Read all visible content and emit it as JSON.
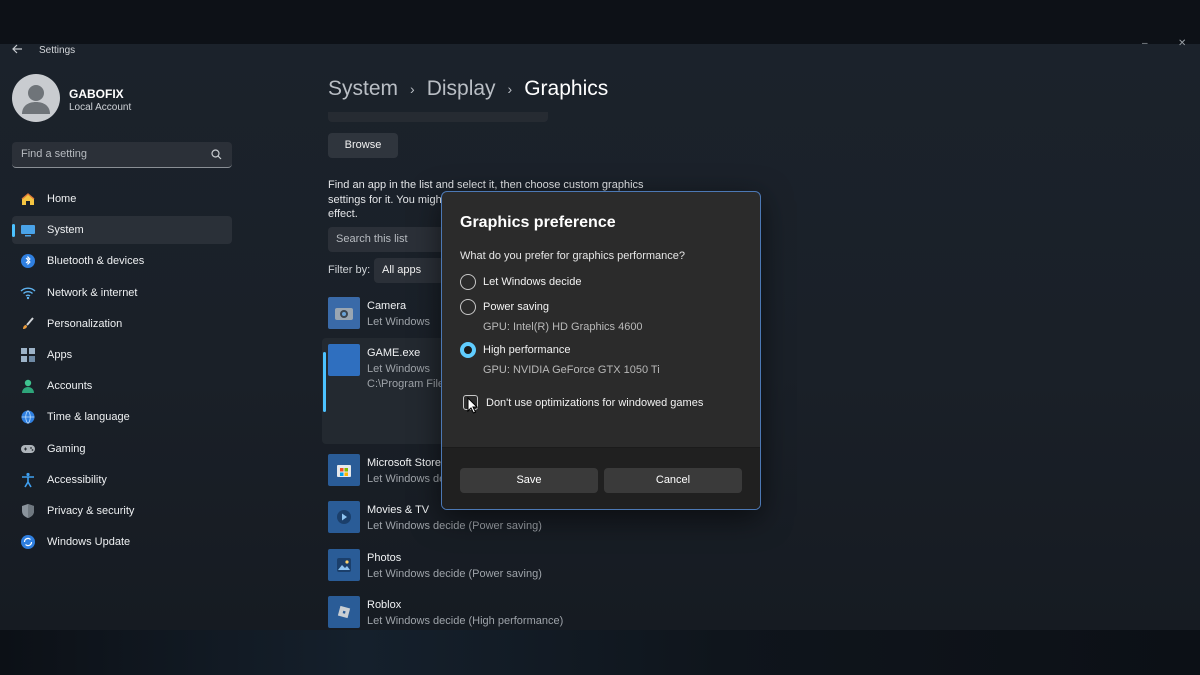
{
  "window": {
    "title": "Settings",
    "minimize_glyph": "–",
    "close_glyph": "✕"
  },
  "profile": {
    "name": "GABOFIX",
    "account_type": "Local Account"
  },
  "search": {
    "placeholder": "Find a setting"
  },
  "nav": {
    "items": [
      {
        "label": "Home",
        "icon": "home-icon"
      },
      {
        "label": "System",
        "icon": "system-icon",
        "active": true
      },
      {
        "label": "Bluetooth & devices",
        "icon": "bluetooth-icon"
      },
      {
        "label": "Network & internet",
        "icon": "wifi-icon"
      },
      {
        "label": "Personalization",
        "icon": "brush-icon"
      },
      {
        "label": "Apps",
        "icon": "apps-icon"
      },
      {
        "label": "Accounts",
        "icon": "person-icon"
      },
      {
        "label": "Time & language",
        "icon": "globe-icon"
      },
      {
        "label": "Gaming",
        "icon": "gamepad-icon"
      },
      {
        "label": "Accessibility",
        "icon": "accessibility-icon"
      },
      {
        "label": "Privacy & security",
        "icon": "shield-icon"
      },
      {
        "label": "Windows Update",
        "icon": "update-icon"
      }
    ]
  },
  "breadcrumb": {
    "items": [
      "System",
      "Display",
      "Graphics"
    ],
    "separator": "›"
  },
  "content": {
    "browse_label": "Browse",
    "description": "Find an app in the list and select it, then choose custom graphics settings for it. You might need to restart the app for changes to take effect.",
    "list_search_placeholder": "Search this list",
    "filter_label": "Filter by:",
    "filter_value": "All apps",
    "apps": [
      {
        "name": "Camera",
        "sub": "Let Windows decide (Power saving)",
        "icon": "camera-icon",
        "tile_color": "#3a6aa8"
      },
      {
        "name": "GAME.exe",
        "sub": "Let Windows decide (Power saving)",
        "path": "C:\\Program Files\\GAME.exe",
        "icon": "game-tile-icon",
        "tile_color": "#2f6fbf",
        "selected": true
      },
      {
        "name": "Microsoft Store",
        "sub": "Let Windows decide (Power saving)",
        "icon": "store-icon",
        "tile_color": "#2a5c97"
      },
      {
        "name": "Movies & TV",
        "sub": "Let Windows decide (Power saving)",
        "icon": "movies-icon",
        "tile_color": "#2a5c97"
      },
      {
        "name": "Photos",
        "sub": "Let Windows decide (Power saving)",
        "icon": "photos-icon",
        "tile_color": "#2a5c97"
      },
      {
        "name": "Roblox",
        "sub": "Let Windows decide (High performance)",
        "icon": "roblox-icon",
        "tile_color": "#2a5c97"
      }
    ]
  },
  "dialog": {
    "title": "Graphics preference",
    "question": "What do you prefer for graphics performance?",
    "options": [
      {
        "label": "Let Windows decide",
        "checked": false
      },
      {
        "label": "Power saving",
        "gpu": "GPU: Intel(R) HD Graphics 4600",
        "checked": false
      },
      {
        "label": "High performance",
        "gpu": "GPU: NVIDIA GeForce GTX 1050 Ti",
        "checked": true
      }
    ],
    "checkbox_label": "Don't use optimizations for windowed games",
    "save_label": "Save",
    "cancel_label": "Cancel"
  },
  "colors": {
    "accent": "#60cdff",
    "dialog_border": "#4c78b4",
    "tile_blue": "#2f6fbf"
  }
}
